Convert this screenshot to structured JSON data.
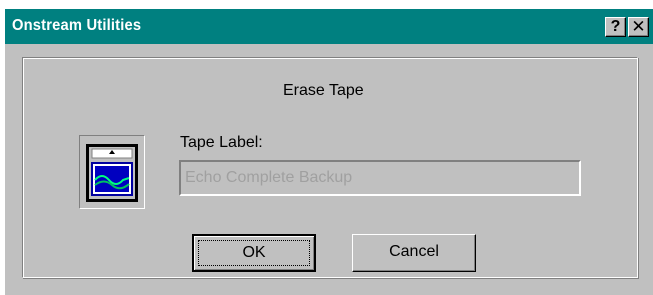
{
  "window": {
    "title": "Onstream Utilities",
    "help_button": "?",
    "close_button": "✕"
  },
  "dialog": {
    "heading": "Erase Tape",
    "tape_label_caption": "Tape Label:",
    "tape_label_value": "Echo Complete Backup",
    "tape_icon": "tape-cartridge-icon"
  },
  "buttons": {
    "ok": "OK",
    "cancel": "Cancel"
  },
  "colors": {
    "titlebar": "#008080",
    "face": "#c0c0c0",
    "disabled_text": "#a0a0a0"
  }
}
